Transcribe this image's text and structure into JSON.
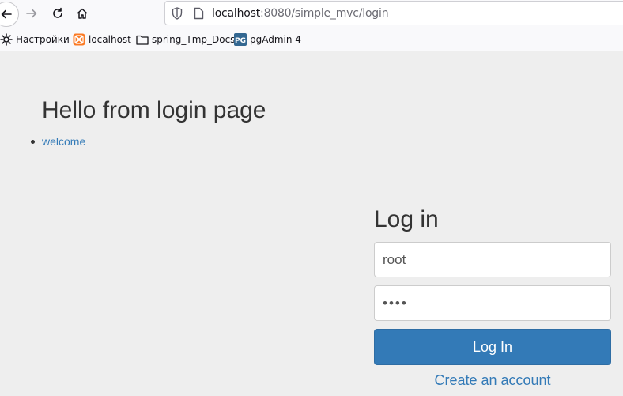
{
  "browser": {
    "url": {
      "host": "localhost",
      "rest": ":8080/simple_mvc/login"
    },
    "bookmarks": [
      {
        "label": "Настройки",
        "icon": "gear-icon"
      },
      {
        "label": "localhost",
        "icon": "xampp-icon"
      },
      {
        "label": "spring_Tmp_Docs",
        "icon": "folder-icon"
      },
      {
        "label": "pgAdmin 4",
        "icon": "pgadmin-icon"
      }
    ]
  },
  "page": {
    "title": "Hello from login page",
    "nav": [
      {
        "label": "welcome"
      }
    ]
  },
  "login": {
    "title": "Log in",
    "username_value": "root",
    "password_value": "••••",
    "submit_label": "Log In",
    "create_account_label": "Create an account"
  },
  "colors": {
    "primary": "#337ab7",
    "background": "#eeeeee"
  }
}
